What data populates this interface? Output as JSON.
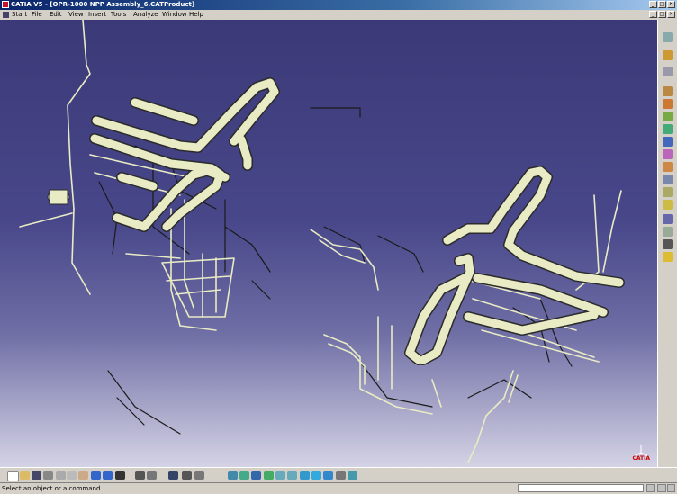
{
  "window": {
    "title": "CATIA V5 - [OPR-1000 NPP Assembly_6.CATProduct]",
    "colors": {
      "titlebar": "#0a246a",
      "chrome": "#d4d0c8",
      "viewport_top": "#3b3977",
      "viewport_bottom": "#d4d3e5",
      "pipe": "#e9ebc4"
    }
  },
  "menu": {
    "items": [
      "Start",
      "File",
      "Edit",
      "View",
      "Insert",
      "Tools",
      "Analyze",
      "Window",
      "Help"
    ]
  },
  "right_toolbar": {
    "icons": [
      "select-icon",
      "pointer-icon",
      "product-icon",
      "component-icon",
      "new-component-icon",
      "new-part-icon",
      "existing-component-icon",
      "replace-icon",
      "graph-tree-icon",
      "renumber-icon",
      "reorder-icon",
      "multi-instantiate-icon",
      "fast-instantiate-icon",
      "bill-of-material-icon",
      "scene-icon",
      "light-icon",
      "camera-icon"
    ]
  },
  "bottom_toolbar": {
    "icons": [
      "new-icon",
      "open-icon",
      "save-icon",
      "print-icon",
      "cut-icon",
      "copy-icon",
      "paste-icon",
      "undo-icon",
      "redo-icon",
      "whats-this-icon",
      "formula-icon",
      "knowledge-icon",
      "catalog-icon",
      "measure-icon",
      "analysis-icon",
      "fly-icon",
      "fit-all-icon",
      "pan-icon",
      "rotate-icon",
      "zoom-in-icon",
      "zoom-out-icon",
      "normal-view-icon",
      "views-icon",
      "render-style-icon",
      "hide-show-icon",
      "swap-space-icon"
    ]
  },
  "compass": {
    "label": "CATIA"
  },
  "status": {
    "message": "Select an object or a command"
  }
}
